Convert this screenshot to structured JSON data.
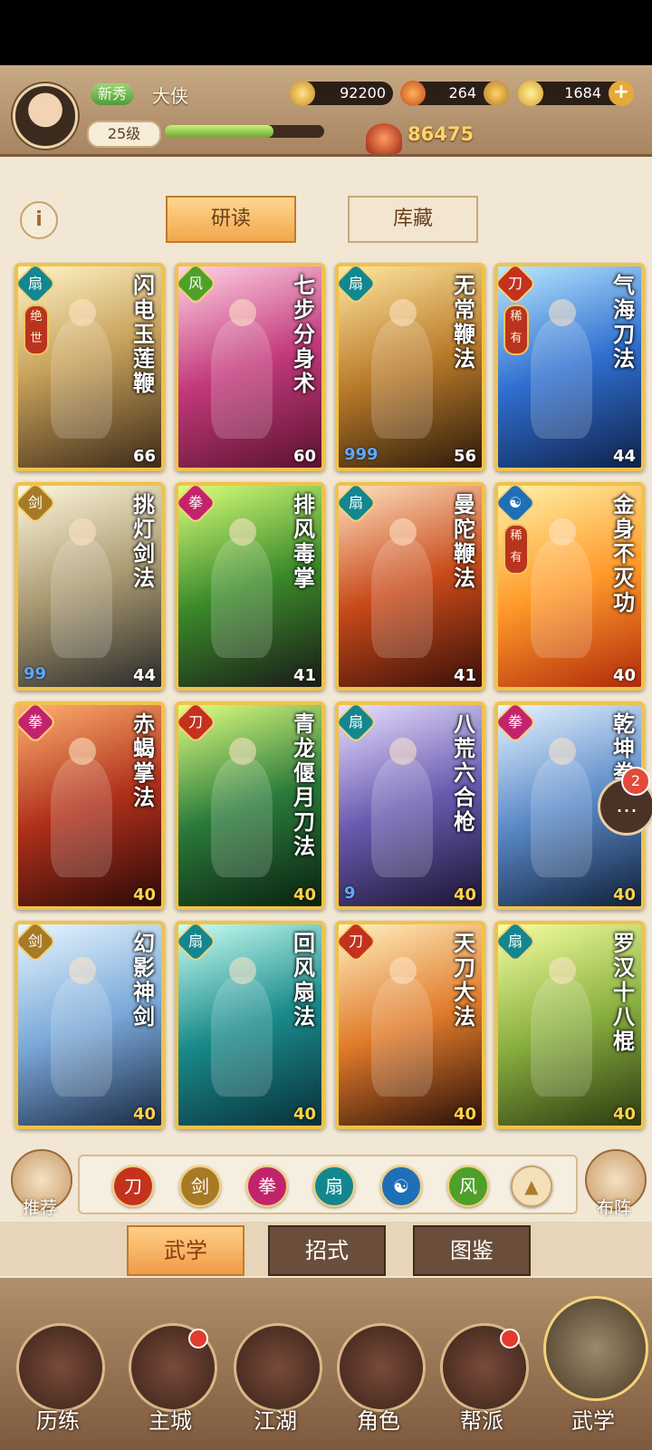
{
  "player": {
    "rank_badge": "新秀",
    "name": "大侠",
    "level": "25级",
    "exp_fraction": 0.68,
    "power": "86475"
  },
  "resources": {
    "coins": "92200",
    "gems": "264",
    "gold_ingots": "1684"
  },
  "top_tabs": [
    "研读",
    "库藏"
  ],
  "cards": [
    {
      "title": "闪电玉莲鞭",
      "level": "66",
      "rarity": "绝世",
      "type": "water"
    },
    {
      "title": "七步分身术",
      "level": "60",
      "type": "wind"
    },
    {
      "title": "无常鞭法",
      "level": "56",
      "drops": "999",
      "type": "water"
    },
    {
      "title": "气海刀法",
      "level": "44",
      "rarity": "稀有",
      "type": "fire"
    },
    {
      "title": "挑灯剑法",
      "level": "44",
      "drops": "99",
      "type": "gold"
    },
    {
      "title": "排风毒掌",
      "level": "41",
      "type": "fist"
    },
    {
      "title": "曼陀鞭法",
      "level": "41",
      "type": "water"
    },
    {
      "title": "金身不灭功",
      "level": "40",
      "rarity": "稀有",
      "type": "taiji"
    },
    {
      "title": "赤蝎掌法",
      "level": "40",
      "type": "fist"
    },
    {
      "title": "青龙偃月刀法",
      "level": "40",
      "type": "fire"
    },
    {
      "title": "八荒六合枪",
      "level": "40",
      "drops": "9",
      "type": "water"
    },
    {
      "title": "乾坤拳",
      "level": "40",
      "type": "fist"
    },
    {
      "title": "幻影神剑",
      "level": "40",
      "type": "gold"
    },
    {
      "title": "回风扇法",
      "level": "40",
      "type": "water"
    },
    {
      "title": "天刀大法",
      "level": "40",
      "type": "fire"
    },
    {
      "title": "罗汉十八棍",
      "level": "40",
      "type": "water"
    }
  ],
  "chat": {
    "badge": "2"
  },
  "filter": {
    "left_label": "推荐",
    "right_label": "布阵",
    "icons": [
      "blade-icon",
      "sword-icon",
      "fist-icon",
      "fan-icon",
      "taiji-icon",
      "wind-icon",
      "collapse-icon"
    ]
  },
  "sub_tabs": [
    "武学",
    "招式",
    "图鉴"
  ],
  "bottom_nav": [
    "历练",
    "主城",
    "江湖",
    "角色",
    "帮派",
    "武学"
  ],
  "colors": {
    "accent": "#f0a84b",
    "card_border": "#f0c24a",
    "level_highlight": "#ffd34a",
    "drop_blue": "#5ea9ff"
  }
}
